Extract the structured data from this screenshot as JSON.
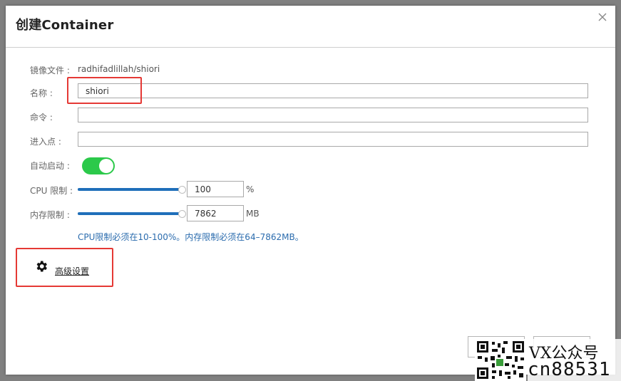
{
  "dialog": {
    "title": "创建Container",
    "close_icon": "close-icon"
  },
  "form": {
    "image": {
      "label": "镜像文件 :",
      "value": "radhifadlillah/shiori"
    },
    "name": {
      "label": "名称 :",
      "value": "shiori",
      "placeholder": ""
    },
    "command": {
      "label": "命令 :",
      "value": "",
      "placeholder": ""
    },
    "entrypoint": {
      "label": "进入点 :",
      "value": "",
      "placeholder": ""
    },
    "autostart": {
      "label": "自动启动 :",
      "on": true
    },
    "cpu_limit": {
      "label": "CPU 限制 :",
      "value": "100",
      "unit": "%",
      "level": 1.0
    },
    "memory_limit": {
      "label": "内存限制 :",
      "value": "7862",
      "unit": "MB",
      "level": 1.0
    },
    "hint": "CPU限制必须在10-100%。内存限制必须在64–7862MB。"
  },
  "advanced": {
    "label": "高级设置",
    "icon": "gear-icon"
  },
  "footer": {
    "create_label": "",
    "cancel_label": ""
  },
  "watermark": {
    "line1": "VX公众号",
    "line2": "cn88531"
  },
  "colors": {
    "toggle_on": "#2bc94a",
    "slider_fill": "#1f6fba",
    "hint_text": "#2b6cae",
    "highlight": "#e53935"
  }
}
